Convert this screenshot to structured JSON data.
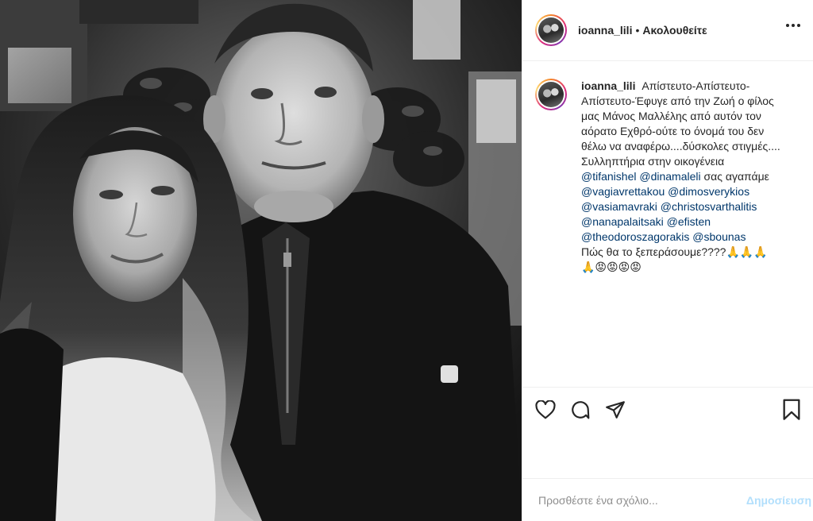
{
  "header": {
    "username": "ioanna_lili",
    "dot": "•",
    "follow_label": "Ακολουθείτε"
  },
  "caption": {
    "username": "ioanna_lili",
    "text_1": "Απίστευτο-Απίστευτο-Απίστευτο-Έφυγε από την Ζωή ο φίλος μας Μάνος Μαλλέλης από αυτόν τον αόρατο Εχθρό-ούτε το όνομά του δεν θέλω να αναφέρω....δύσκολες στιγμές.... Συλληπτήρια στην οικογένεια",
    "mentions_1": [
      "@tifanishel",
      "@dinamaleli"
    ],
    "text_2": "σας αγαπάμε",
    "mentions_2": [
      "@vagiavrettakou",
      "@dimosverykios",
      "@vasiamavraki",
      "@christosvarthalitis",
      "@nanapalaitsaki",
      "@efisten",
      "@theodoroszagorakis",
      "@sbounas"
    ],
    "text_3": "Πώς θα το ξεπεράσουμε????🙏🙏🙏",
    "emoji_line": "🙏😡😡😡😡"
  },
  "actions": {
    "like_icon": "heart-icon",
    "comment_icon": "comment-icon",
    "share_icon": "share-icon",
    "save_icon": "bookmark-icon"
  },
  "comment": {
    "placeholder": "Προσθέστε ένα σχόλιο...",
    "post_label": "Δημοσίευση",
    "post_color": "#b2dffc"
  },
  "colors": {
    "text": "#262626",
    "mention": "#00376b",
    "divider": "#efefef",
    "placeholder": "#8e8e8e"
  }
}
